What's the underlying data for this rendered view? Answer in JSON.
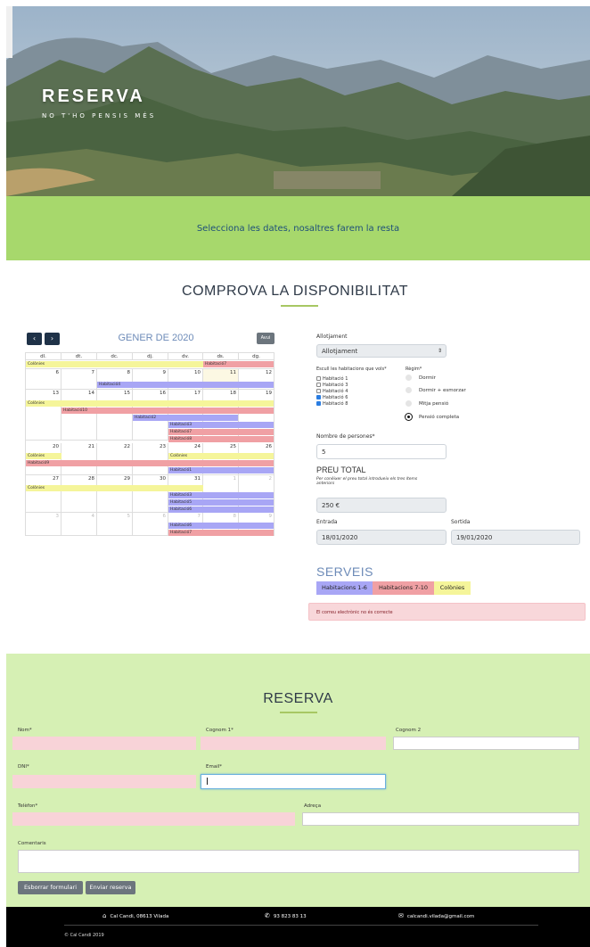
{
  "hero": {
    "title": "RESERVA",
    "subtitle": "NO T'HO PENSIS MÉS"
  },
  "band": {
    "text": "Selecciona les dates, nosaltres farem la resta"
  },
  "availability": {
    "title": "COMPROVA LA DISPONIBILITAT"
  },
  "calendar": {
    "prev": "‹",
    "next": "›",
    "title": "GENER DE 2020",
    "today_label": "Avui",
    "weekdays": [
      "dl.",
      "dt.",
      "dc.",
      "dj.",
      "dv.",
      "ds.",
      "dg."
    ],
    "weeks": [
      {
        "days": [
          "",
          "",
          "",
          "",
          "",
          "",
          ""
        ]
      },
      {
        "days": [
          "6",
          "7",
          "8",
          "9",
          "10",
          "11",
          "12"
        ]
      },
      {
        "days": [
          "13",
          "14",
          "15",
          "16",
          "17",
          "18",
          "19"
        ]
      },
      {
        "days": [
          "20",
          "21",
          "22",
          "23",
          "24",
          "25",
          "26"
        ]
      },
      {
        "days": [
          "27",
          "28",
          "29",
          "30",
          "31",
          "1",
          "2"
        ]
      },
      {
        "days": [
          "3",
          "4",
          "5",
          "6",
          "7",
          "8",
          "9"
        ]
      }
    ],
    "events": {
      "w0a": "Colònies",
      "w0b": "Habitació7",
      "w1a": "Habitació4",
      "w2a": "Colònies",
      "w2b": "Habitació10",
      "w2c": "Habitació2",
      "w2d": "Habitació3",
      "w2e": "Habitació7",
      "w2f": "Habitació8",
      "w3a": "Colònies",
      "w3b": "Colònies",
      "w3c": "Habitació9",
      "w3d": "Habitació1",
      "w4a": "Colònies",
      "w4b": "Habitació3",
      "w4c": "Habitació5",
      "w4d": "Habitació6",
      "w5a": "Habitació6",
      "w5b": "Habitació7"
    }
  },
  "booking": {
    "allotjament_label": "Allotjament",
    "allotjament_value": "Allotjament",
    "rooms_label": "Escull les habitacions que vols*",
    "rooms": [
      "Habitació 1",
      "Habitació 3",
      "Habitació 4",
      "Habitació 6",
      "Habitació 8"
    ],
    "regim_label": "Règim*",
    "regims": [
      "Dormir",
      "Dormir + esmorzar",
      "Mitja pensió",
      "Pensió completa"
    ],
    "persons_label": "Nombre de persones*",
    "persons_value": "5",
    "price_title": "PREU TOTAL",
    "price_note": "Per conèixer el preu total introdueix els tres ítems anteriors",
    "price_value": "250 €",
    "entrada_label": "Entrada",
    "entrada_value": "18/01/2020",
    "sortida_label": "Sortida",
    "sortida_value": "19/01/2020"
  },
  "services": {
    "title": "SERVEIS",
    "tags": [
      "Habitacions 1-6",
      "Habitacions 7-10",
      "Colònies"
    ],
    "alert": "El correu electrònic no és correcte"
  },
  "reserva": {
    "title": "RESERVA",
    "nom_label": "Nom*",
    "cognom1_label": "Cognom 1*",
    "cognom2_label": "Cognom 2",
    "dni_label": "DNI*",
    "email_label": "Email*",
    "telefon_label": "Telèfon*",
    "adreca_label": "Adreça",
    "comentaris_label": "Comentaris",
    "reset_button": "Esborrar formulari",
    "submit_button": "Enviar reserva"
  },
  "footer": {
    "address": "Cal Candi, 08613 Vilada",
    "phone": "93 823 83 13",
    "email": "calcandi.vilada@gmail.com",
    "copyright": "© Cal Candi 2019"
  },
  "colors": {
    "green_band": "#a7d86c",
    "form_bg": "#d6f0b4",
    "rooms_1_6": "#a8a6f5",
    "rooms_7_10": "#f0a0a4",
    "colonies": "#f5f59a",
    "accent_blue": "#6d8bb8"
  }
}
